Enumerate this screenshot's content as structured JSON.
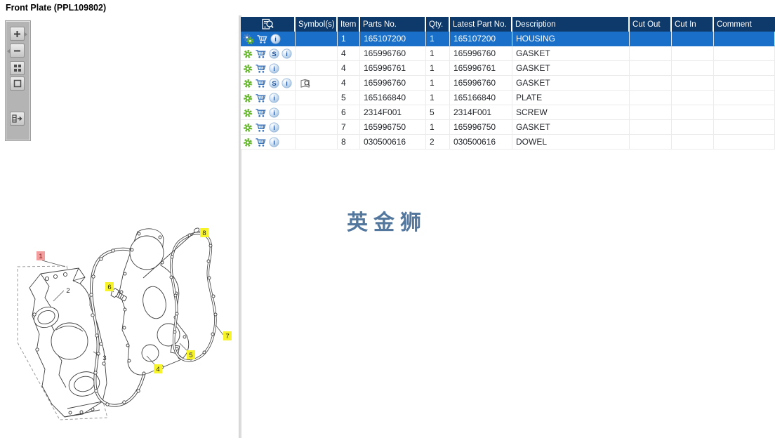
{
  "window": {
    "title": "Front Plate (PPL109802)"
  },
  "watermark": "英金狮",
  "colors": {
    "header_bg": "#0d3a6b",
    "selected_row_bg": "#1a70c8",
    "watermark": "#54779e",
    "callout_yellow": "#f7f32a",
    "callout_selected_bg": "#f29e9e",
    "callout_selected_text": "#7a1010",
    "gear_green": "#64b52c",
    "gear_blue": "#4d7ec2",
    "cart_blue": "#3a72b8",
    "sphere_text_blue": "#1d4f93"
  },
  "toolbar": {
    "buttons": [
      {
        "name": "zoom-in",
        "icon": "plus-icon"
      },
      {
        "name": "zoom-out",
        "icon": "minus-icon"
      },
      {
        "name": "tile-view",
        "icon": "grid-icon"
      },
      {
        "name": "fit-view",
        "icon": "square-icon"
      },
      {
        "name": "collapse-panel",
        "icon": "panel-arrow-icon"
      }
    ]
  },
  "table": {
    "columns": [
      "",
      "Symbol(s)",
      "Item",
      "Parts No.",
      "Qty.",
      "Latest Part No.",
      "Description",
      "Cut Out",
      "Cut In",
      "Comment"
    ],
    "rows": [
      {
        "selected": true,
        "icons": [
          "gears",
          "cart",
          "info"
        ],
        "symbol": false,
        "item": "1",
        "parts_no": "165107200",
        "qty": "1",
        "latest_part_no": "165107200",
        "description": "HOUSING",
        "cut_out": "",
        "cut_in": "",
        "comment": ""
      },
      {
        "selected": false,
        "icons": [
          "gear",
          "cart",
          "s",
          "info"
        ],
        "symbol": false,
        "item": "4",
        "parts_no": "165996760",
        "qty": "1",
        "latest_part_no": "165996760",
        "description": "GASKET",
        "cut_out": "",
        "cut_in": "",
        "comment": ""
      },
      {
        "selected": false,
        "icons": [
          "gear",
          "cart",
          "info"
        ],
        "symbol": false,
        "item": "4",
        "parts_no": "165996761",
        "qty": "1",
        "latest_part_no": "165996761",
        "description": "GASKET",
        "cut_out": "",
        "cut_in": "",
        "comment": ""
      },
      {
        "selected": false,
        "icons": [
          "gear",
          "cart",
          "s",
          "info"
        ],
        "symbol": true,
        "item": "4",
        "parts_no": "165996760",
        "qty": "1",
        "latest_part_no": "165996760",
        "description": "GASKET",
        "cut_out": "",
        "cut_in": "",
        "comment": ""
      },
      {
        "selected": false,
        "icons": [
          "gear",
          "cart",
          "info"
        ],
        "symbol": false,
        "item": "5",
        "parts_no": "165166840",
        "qty": "1",
        "latest_part_no": "165166840",
        "description": "PLATE",
        "cut_out": "",
        "cut_in": "",
        "comment": ""
      },
      {
        "selected": false,
        "icons": [
          "gear",
          "cart",
          "info"
        ],
        "symbol": false,
        "item": "6",
        "parts_no": "2314F001",
        "qty": "5",
        "latest_part_no": "2314F001",
        "description": "SCREW",
        "cut_out": "",
        "cut_in": "",
        "comment": ""
      },
      {
        "selected": false,
        "icons": [
          "gear",
          "cart",
          "info"
        ],
        "symbol": false,
        "item": "7",
        "parts_no": "165996750",
        "qty": "1",
        "latest_part_no": "165996750",
        "description": "GASKET",
        "cut_out": "",
        "cut_in": "",
        "comment": ""
      },
      {
        "selected": false,
        "icons": [
          "gear",
          "cart",
          "info"
        ],
        "symbol": false,
        "item": "8",
        "parts_no": "030500616",
        "qty": "2",
        "latest_part_no": "030500616",
        "description": "DOWEL",
        "cut_out": "",
        "cut_in": "",
        "comment": ""
      }
    ]
  },
  "diagram": {
    "callouts": [
      {
        "label": "1",
        "style": "selected"
      },
      {
        "label": "2",
        "style": "plain"
      },
      {
        "label": "3",
        "style": "plain"
      },
      {
        "label": "4",
        "style": "part"
      },
      {
        "label": "5",
        "style": "part"
      },
      {
        "label": "6",
        "style": "part"
      },
      {
        "label": "7",
        "style": "part"
      },
      {
        "label": "8",
        "style": "part"
      }
    ]
  }
}
